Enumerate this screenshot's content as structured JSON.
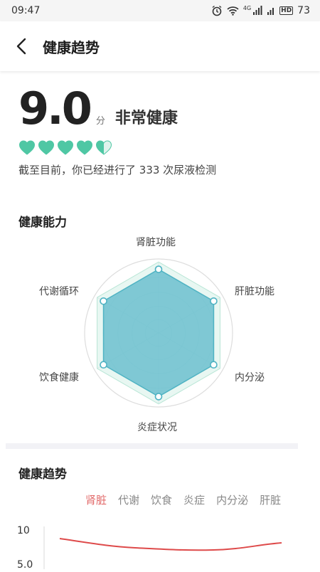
{
  "status_bar": {
    "time": "09:47",
    "network": "4G",
    "hd": "HD",
    "battery": "73"
  },
  "header": {
    "title": "健康趋势"
  },
  "score": {
    "value": "9.0",
    "unit": "分",
    "status": "非常健康",
    "hearts_filled": 4.5,
    "hearts_total": 5,
    "count_text": "截至目前，你已经进行了 333 次尿液检测"
  },
  "ability": {
    "title": "健康能力",
    "axes": [
      "肾脏功能",
      "肝脏功能",
      "内分泌",
      "炎症状况",
      "饮食健康",
      "代谢循环"
    ]
  },
  "trend": {
    "title": "健康趋势",
    "tabs": [
      "肾脏",
      "代谢",
      "饮食",
      "炎症",
      "内分泌",
      "肝脏"
    ],
    "active_tab": 0,
    "y_ticks": [
      "10",
      "5.0"
    ]
  },
  "colors": {
    "accent_green": "#4fc7a4",
    "radar_fill": "#6cc0cf",
    "trend_line": "#de4a4a",
    "active_tab": "#e26a6a"
  }
}
